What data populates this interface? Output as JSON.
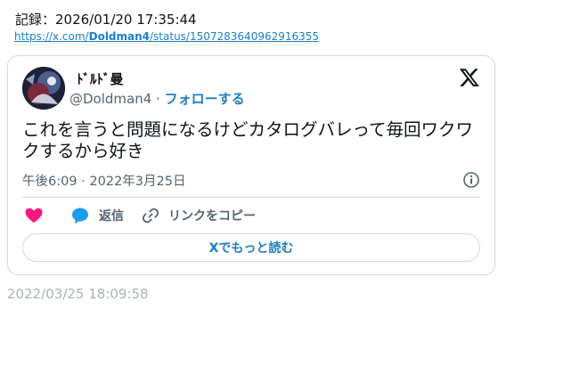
{
  "record": {
    "label": "記録：2026/01/20 17:35:44",
    "url_prefix": "https://x.com/",
    "url_user": "Doldman4",
    "url_suffix": "/status/1507283640962916355"
  },
  "tweet": {
    "display_name": "ﾄﾞﾙﾄﾞ曼",
    "handle": "@Doldman4",
    "separator": " · ",
    "follow_label": "フォローする",
    "text": "これを言うと問題になるけどカタログバレって毎回ワクワクするから好き",
    "time": "午後6:09 · 2022年3月25日",
    "reply_label": "返信",
    "copy_link_label": "リンクをコピー",
    "read_more_label": "Xでもっと読む"
  },
  "footer": {
    "timestamp": "2022/03/25 18:09:58"
  },
  "icons": {
    "logo": "x-logo-icon",
    "info": "info-icon",
    "like": "heart-icon",
    "reply": "speech-bubble-icon",
    "link": "link-icon"
  },
  "colors": {
    "link": "#1d7fbf",
    "heart": "#f91880",
    "reply": "#1d9bf0",
    "muted": "#536471",
    "border": "#cfd9de"
  }
}
